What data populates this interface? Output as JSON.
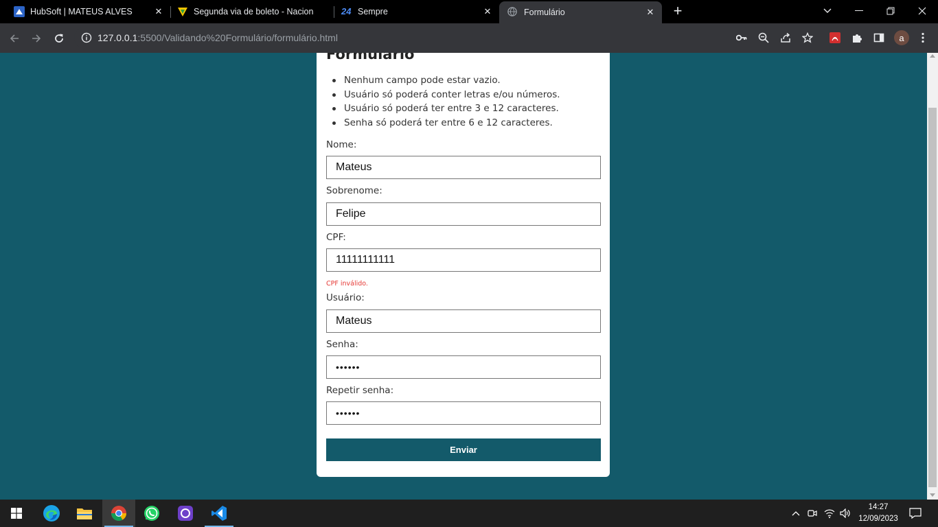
{
  "browser": {
    "tabs": [
      {
        "title": "HubSoft | MATEUS ALVES",
        "icon": "hubsoft-icon",
        "active": false
      },
      {
        "title": "Segunda via de boleto - Nacional",
        "icon": "nacional-icon",
        "active": false
      },
      {
        "title": "Sempre",
        "icon": "sempre-24-icon",
        "active": false
      },
      {
        "title": "Formulário",
        "icon": "globe-icon",
        "active": true
      }
    ],
    "url_host": "127.0.0.1",
    "url_path": ":5500/Validando%20Formulário/formulário.html",
    "profile_initial": "a"
  },
  "form": {
    "title": "Formulário",
    "rules": [
      "Nenhum campo pode estar vazio.",
      "Usuário só poderá conter letras e/ou números.",
      "Usuário só poderá ter entre 3 e 12 caracteres.",
      "Senha só poderá ter entre 6 e 12 caracteres."
    ],
    "fields": {
      "nome": {
        "label": "Nome:",
        "value": "Mateus"
      },
      "sobrenome": {
        "label": "Sobrenome:",
        "value": "Felipe"
      },
      "cpf": {
        "label": "CPF:",
        "value": "11111111111",
        "error": "CPF inválido."
      },
      "usuario": {
        "label": "Usuário:",
        "value": "Mateus"
      },
      "senha": {
        "label": "Senha:",
        "value": "••••••"
      },
      "repetir_senha": {
        "label": "Repetir senha:",
        "value": "••••••"
      }
    },
    "submit_label": "Enviar"
  },
  "taskbar": {
    "time": "14:27",
    "date": "12/09/2023",
    "apps": [
      "start-icon",
      "edge-icon",
      "file-explorer-icon",
      "chrome-icon",
      "whatsapp-icon",
      "github-desktop-icon",
      "vscode-icon"
    ]
  },
  "colors": {
    "page_bg": "#135a6a",
    "button_bg": "#135a6a",
    "error": "#e53935"
  }
}
